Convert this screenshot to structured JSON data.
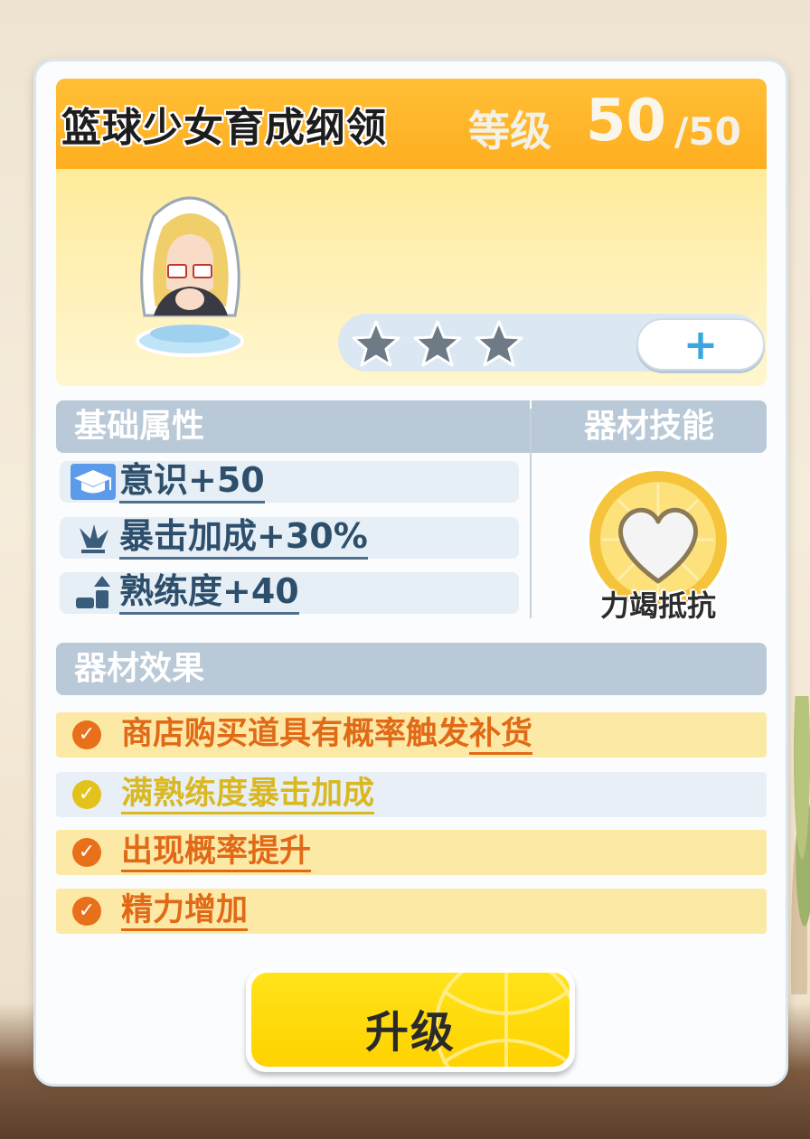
{
  "title": {
    "name": "篮球少女育成纲领",
    "level_label": "等级",
    "level_value": "50",
    "level_max": "/50"
  },
  "stars": {
    "filled": 0,
    "total": 3
  },
  "plus_button": "+",
  "basic_attributes": {
    "header": "基础属性",
    "items": [
      {
        "icon": "graduation-cap-icon",
        "text": "意识+50"
      },
      {
        "icon": "crit-burst-icon",
        "text": "暴击加成+30%"
      },
      {
        "icon": "proficiency-up-icon",
        "text": "熟练度+40"
      }
    ]
  },
  "equipment_skill": {
    "header": "器材技能",
    "icon": "heart-badge-icon",
    "name": "力竭抵抗"
  },
  "equipment_effects": {
    "header": "器材效果",
    "items": [
      {
        "prefix": "商店购买道具有概率触发",
        "link": "补货",
        "state": "active"
      },
      {
        "prefix": "",
        "link": "满熟练度暴击加成",
        "state": "inactive"
      },
      {
        "prefix": "",
        "link": "出现概率提升",
        "state": "active"
      },
      {
        "prefix": "",
        "link": "精力增加",
        "state": "active"
      }
    ]
  },
  "upgrade_button": "升级",
  "colors": {
    "title_bar": "#ffb42a",
    "active_effect_bg": "#fde9a6",
    "inactive_effect_bg": "#e8eff6",
    "active_check": "#e8701a",
    "inactive_check": "#e3c21c",
    "upgrade": "#ffd800"
  }
}
